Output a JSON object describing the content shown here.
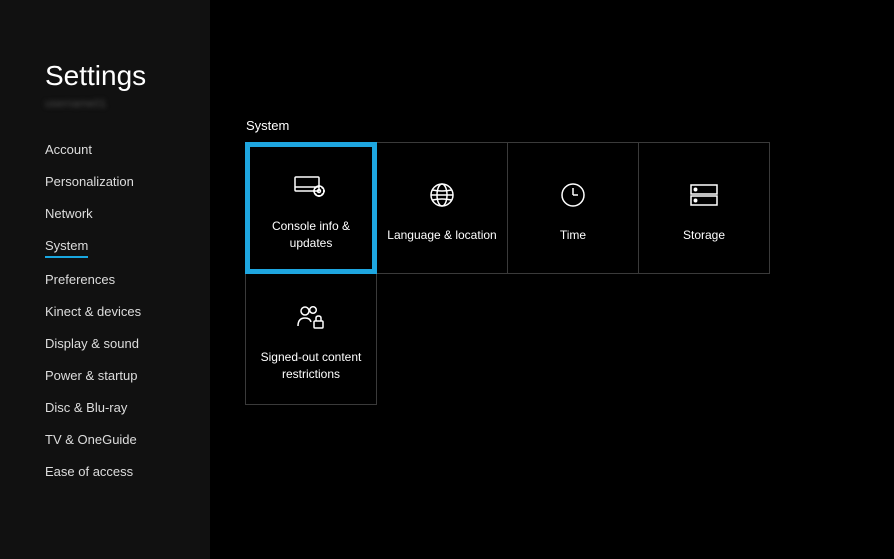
{
  "sidebar": {
    "title": "Settings",
    "subtitle": "username01",
    "items": [
      {
        "label": "Account",
        "active": false
      },
      {
        "label": "Personalization",
        "active": false
      },
      {
        "label": "Network",
        "active": false
      },
      {
        "label": "System",
        "active": true
      },
      {
        "label": "Preferences",
        "active": false
      },
      {
        "label": "Kinect & devices",
        "active": false
      },
      {
        "label": "Display & sound",
        "active": false
      },
      {
        "label": "Power & startup",
        "active": false
      },
      {
        "label": "Disc & Blu-ray",
        "active": false
      },
      {
        "label": "TV & OneGuide",
        "active": false
      },
      {
        "label": "Ease of access",
        "active": false
      }
    ]
  },
  "main": {
    "section_label": "System",
    "tiles": [
      {
        "label": "Console info & updates",
        "icon": "console-gear-icon",
        "selected": true
      },
      {
        "label": "Language & location",
        "icon": "globe-icon",
        "selected": false
      },
      {
        "label": "Time",
        "icon": "clock-icon",
        "selected": false
      },
      {
        "label": "Storage",
        "icon": "storage-icon",
        "selected": false
      },
      {
        "label": "Signed-out content restrictions",
        "icon": "people-lock-icon",
        "selected": false
      }
    ]
  }
}
